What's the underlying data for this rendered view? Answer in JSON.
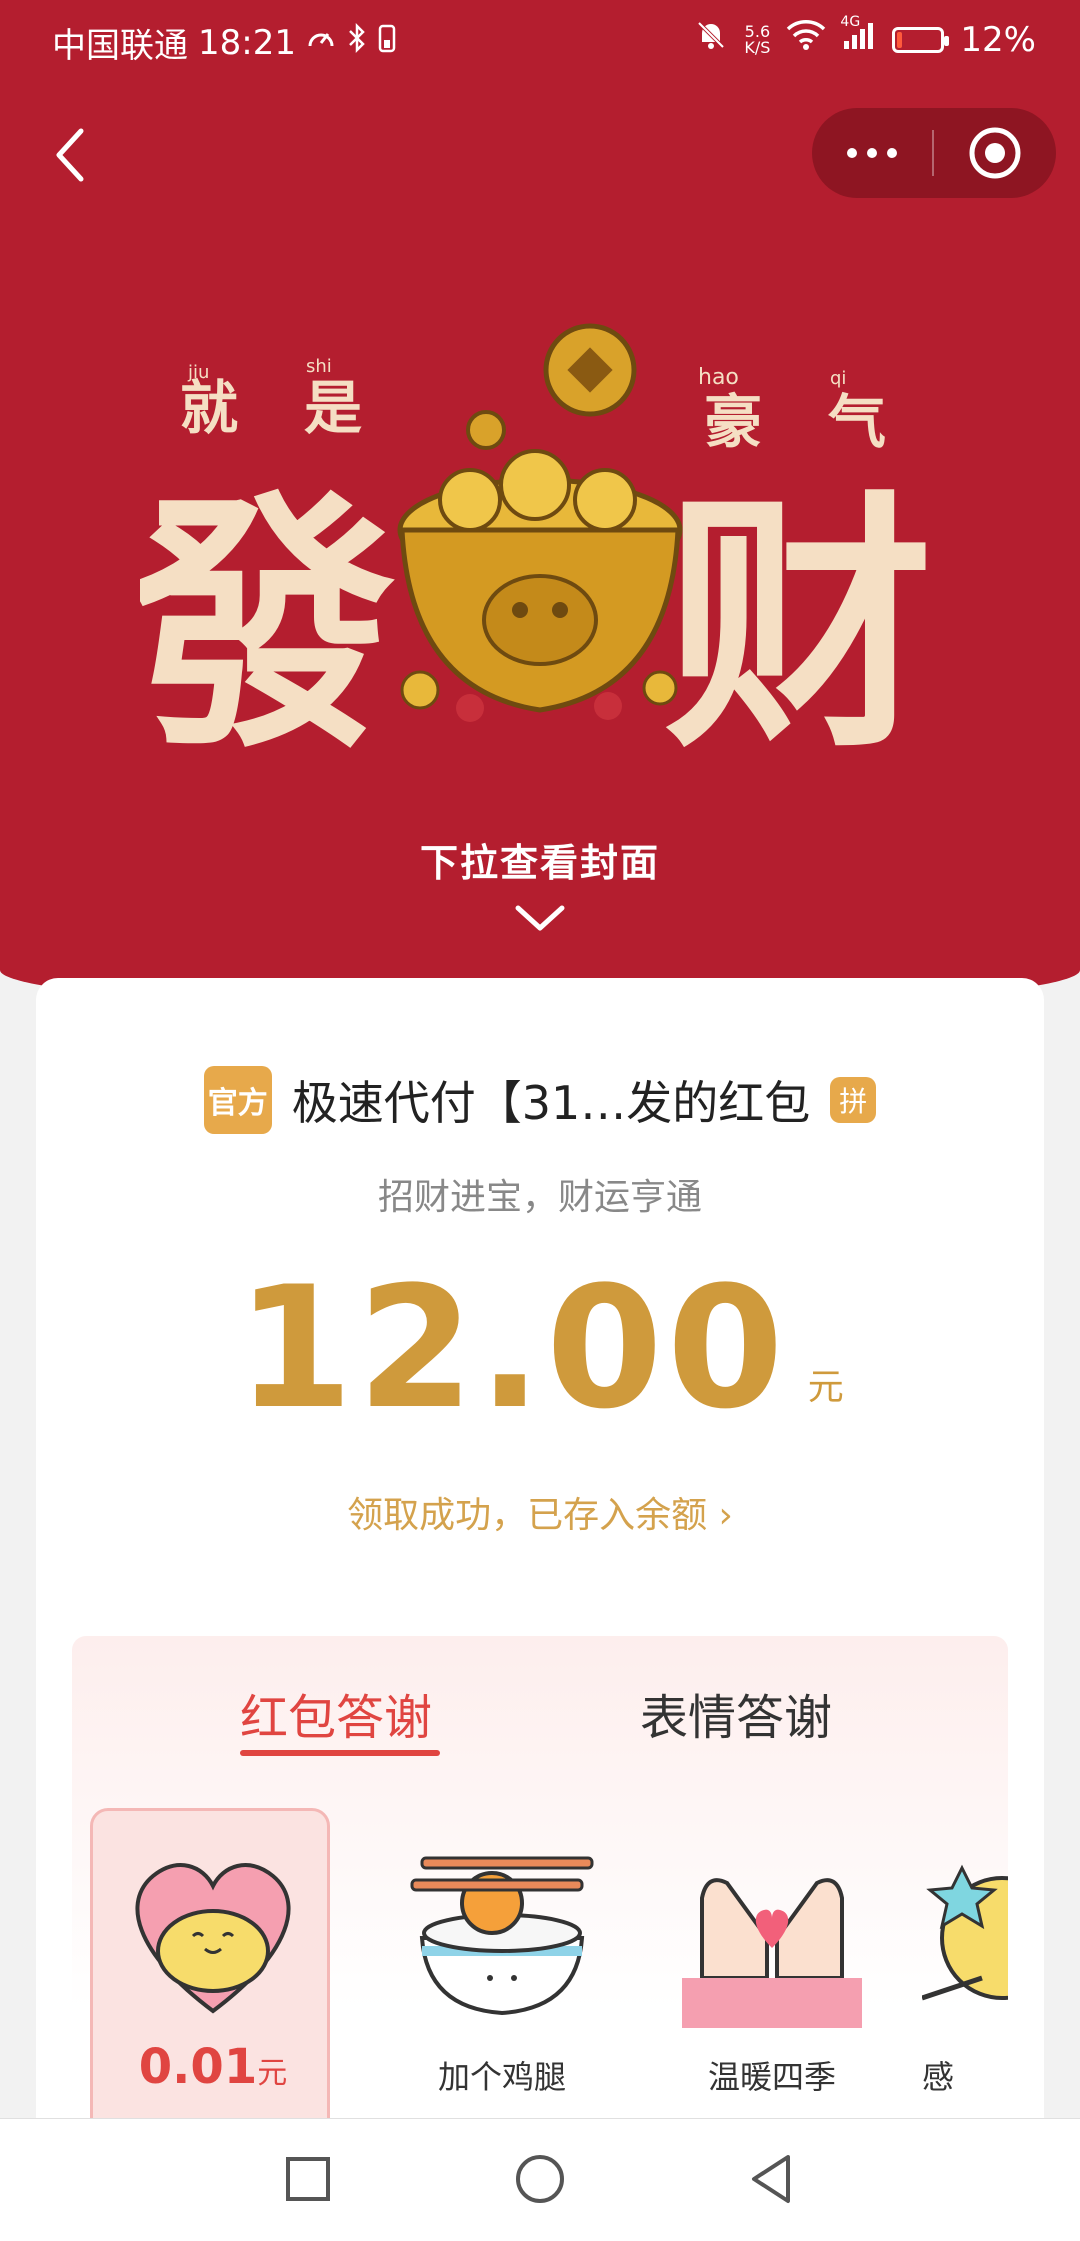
{
  "status_bar": {
    "carrier": "中国联通",
    "time": "18:21",
    "speed_value": "5.6",
    "speed_unit": "K/S",
    "network": "4G",
    "battery_percent": "12%",
    "battery_level": 0.12
  },
  "art": {
    "pinyin_1": "jiu",
    "pinyin_2": "shi",
    "pinyin_3": "hao",
    "pinyin_4": "qi",
    "small_1": "就",
    "small_2": "是",
    "small_3": "豪",
    "small_4": "气",
    "big_left": "發",
    "big_right": "财"
  },
  "header": {
    "pull_hint": "下拉查看封面"
  },
  "card": {
    "official_badge": "官方",
    "sender_name": "极速代付【31…发的红包",
    "pin_badge": "拼",
    "blessing": "招财进宝，财运亨通",
    "amount": "12.00",
    "amount_unit": "元",
    "claim_text": "领取成功，已存入余额 ›"
  },
  "thanks": {
    "tabs": [
      {
        "label": "红包答谢",
        "active": true
      },
      {
        "label": "表情答谢",
        "active": false
      }
    ],
    "gifts": [
      {
        "label": "",
        "price": "0.01",
        "unit": "元",
        "selected": true
      },
      {
        "label": "加个鸡腿"
      },
      {
        "label": "温暖四季"
      },
      {
        "label": "感"
      }
    ]
  },
  "colors": {
    "header_red": "#b41e2f",
    "gold": "#cf9a3c",
    "accent_red": "#e04541",
    "badge_gold": "#e7a94b"
  }
}
